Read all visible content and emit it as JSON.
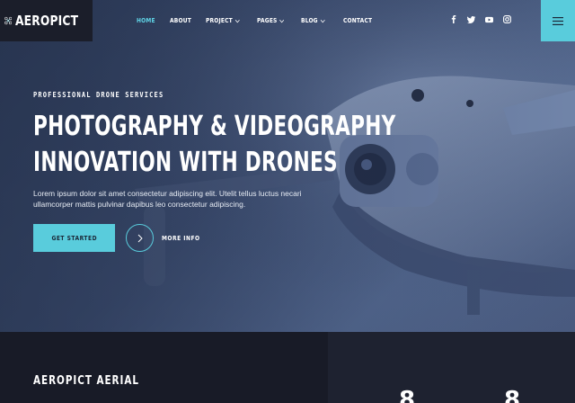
{
  "brand": {
    "name": "AEROPICT"
  },
  "nav": {
    "items": [
      {
        "label": "HOME",
        "active": true,
        "dropdown": false
      },
      {
        "label": "ABOUT",
        "active": false,
        "dropdown": false
      },
      {
        "label": "PROJECT",
        "active": false,
        "dropdown": true
      },
      {
        "label": "PAGES",
        "active": false,
        "dropdown": true
      },
      {
        "label": "BLOG",
        "active": false,
        "dropdown": true
      },
      {
        "label": "CONTACT",
        "active": false,
        "dropdown": false
      }
    ]
  },
  "social": [
    "facebook-icon",
    "twitter-icon",
    "youtube-icon",
    "instagram-icon"
  ],
  "hero": {
    "eyebrow": "PROFESSIONAL DRONE SERVICES",
    "headline_line1": "PHOTOGRAPHY & VIDEOGRAPHY",
    "headline_line2": "INNOVATION WITH DRONES",
    "description": "Lorem ipsum dolor sit amet consectetur adipiscing elit. Utelit tellus luctus necari ullamcorper mattis pulvinar dapibus leo consectetur adipiscing.",
    "primary_button": "GET STARTED",
    "secondary_button": "MORE INFO"
  },
  "section": {
    "title": "AEROPICT AERIAL",
    "glyph_left": "8",
    "glyph_right": "8"
  },
  "colors": {
    "accent": "#59ccdc",
    "dark": "#1b1e2a"
  }
}
